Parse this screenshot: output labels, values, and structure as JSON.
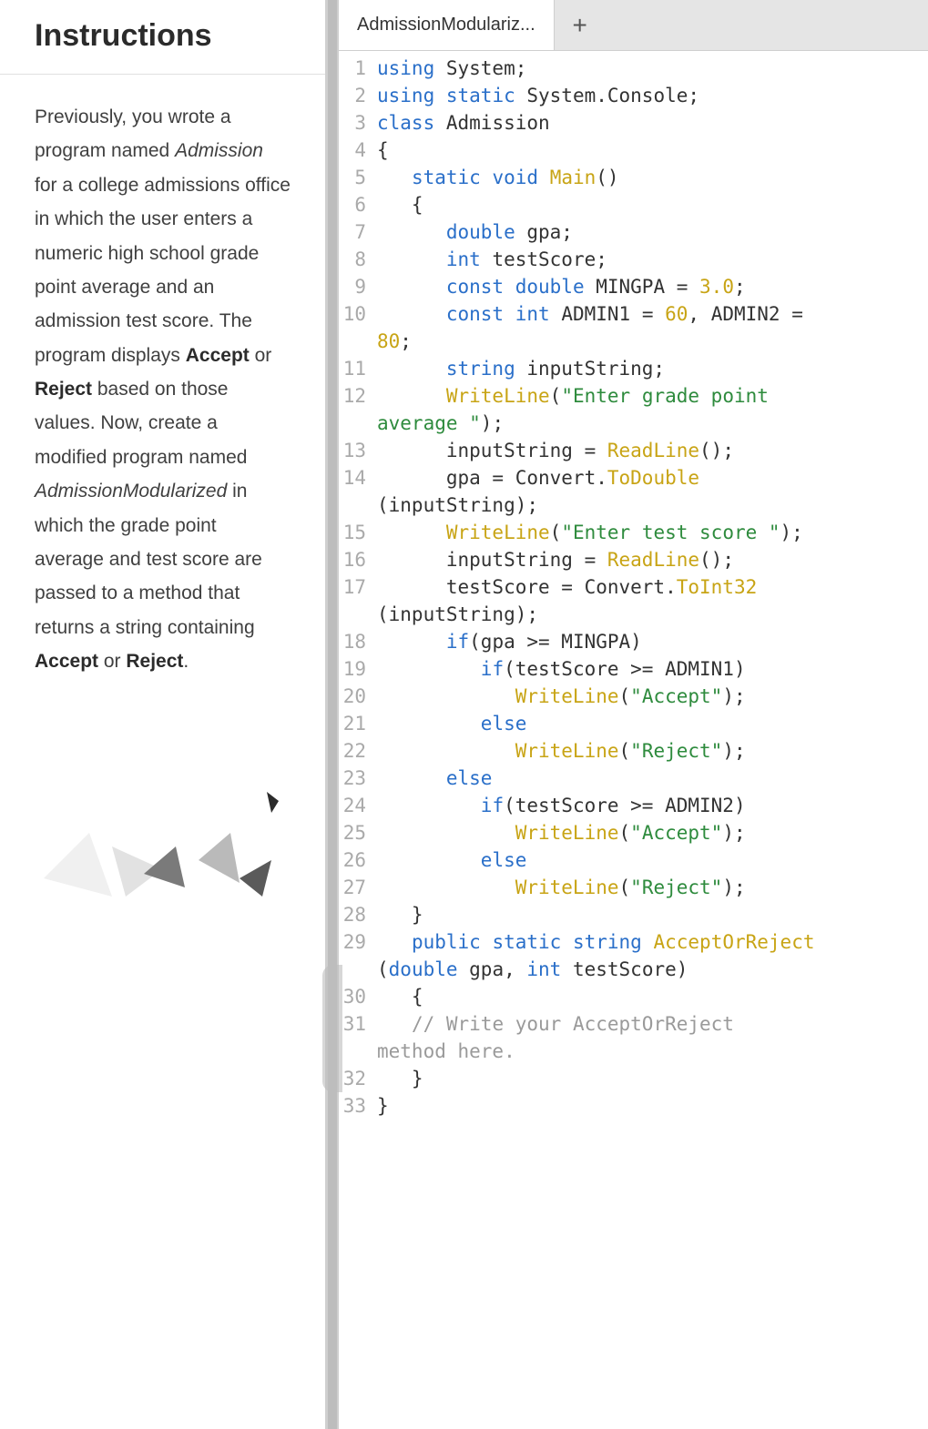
{
  "left": {
    "title": "Instructions",
    "para_parts": [
      {
        "t": "Previously, you wrote a program named "
      },
      {
        "t": "Admission",
        "em": true
      },
      {
        "t": " for a college admissions office in which the user enters a numeric high school grade point average and an admission test score. The program displays "
      },
      {
        "t": "Accept",
        "strong": true
      },
      {
        "t": " or "
      },
      {
        "t": "Reject",
        "strong": true
      },
      {
        "t": " based on those values. Now, create a modified program named "
      },
      {
        "t": "AdmissionModularized",
        "em": true
      },
      {
        "t": " in which the grade point average and test score are passed to a method that returns a string containing "
      },
      {
        "t": "Accept",
        "strong": true
      },
      {
        "t": " or "
      },
      {
        "t": "Reject",
        "strong": true
      },
      {
        "t": "."
      }
    ]
  },
  "tabs": {
    "active_label": "AdmissionModulariz...",
    "add_label": "+"
  },
  "code": {
    "lines": [
      {
        "n": 1,
        "rows": [
          [
            {
              "c": "tk-kw",
              "t": "using"
            },
            {
              "t": " System;"
            }
          ]
        ]
      },
      {
        "n": 2,
        "rows": [
          [
            {
              "c": "tk-kw",
              "t": "using"
            },
            {
              "t": " "
            },
            {
              "c": "tk-kw",
              "t": "static"
            },
            {
              "t": " System.Console;"
            }
          ]
        ]
      },
      {
        "n": 3,
        "rows": [
          [
            {
              "c": "tk-kw",
              "t": "class"
            },
            {
              "t": " "
            },
            {
              "c": "tk-cls",
              "t": "Admission"
            }
          ]
        ]
      },
      {
        "n": 4,
        "rows": [
          [
            {
              "t": "{"
            }
          ]
        ]
      },
      {
        "n": 5,
        "rows": [
          [
            {
              "t": "   "
            },
            {
              "c": "tk-kw",
              "t": "static"
            },
            {
              "t": " "
            },
            {
              "c": "tk-kw",
              "t": "void"
            },
            {
              "t": " "
            },
            {
              "c": "tk-fn",
              "t": "Main"
            },
            {
              "t": "()"
            }
          ]
        ]
      },
      {
        "n": 6,
        "rows": [
          [
            {
              "t": "   {"
            }
          ]
        ]
      },
      {
        "n": 7,
        "rows": [
          [
            {
              "t": "      "
            },
            {
              "c": "tk-type",
              "t": "double"
            },
            {
              "t": " gpa;"
            }
          ]
        ]
      },
      {
        "n": 8,
        "rows": [
          [
            {
              "t": "      "
            },
            {
              "c": "tk-type",
              "t": "int"
            },
            {
              "t": " testScore;"
            }
          ]
        ]
      },
      {
        "n": 9,
        "rows": [
          [
            {
              "t": "      "
            },
            {
              "c": "tk-kw",
              "t": "const"
            },
            {
              "t": " "
            },
            {
              "c": "tk-type",
              "t": "double"
            },
            {
              "t": " MINGPA = "
            },
            {
              "c": "tk-num",
              "t": "3.0"
            },
            {
              "t": ";"
            }
          ]
        ]
      },
      {
        "n": 10,
        "rows": [
          [
            {
              "t": "      "
            },
            {
              "c": "tk-kw",
              "t": "const"
            },
            {
              "t": " "
            },
            {
              "c": "tk-type",
              "t": "int"
            },
            {
              "t": " ADMIN1 = "
            },
            {
              "c": "tk-num",
              "t": "60"
            },
            {
              "t": ", ADMIN2 = "
            }
          ],
          [
            {
              "c": "tk-num",
              "t": "80"
            },
            {
              "t": ";"
            }
          ]
        ]
      },
      {
        "n": 11,
        "rows": [
          [
            {
              "t": "      "
            },
            {
              "c": "tk-type",
              "t": "string"
            },
            {
              "t": " inputString;"
            }
          ]
        ]
      },
      {
        "n": 12,
        "rows": [
          [
            {
              "t": "      "
            },
            {
              "c": "tk-fn",
              "t": "WriteLine"
            },
            {
              "t": "("
            },
            {
              "c": "tk-str",
              "t": "\"Enter grade point "
            }
          ],
          [
            {
              "c": "tk-str",
              "t": "average \""
            },
            {
              "t": ");"
            }
          ]
        ]
      },
      {
        "n": 13,
        "rows": [
          [
            {
              "t": "      inputString = "
            },
            {
              "c": "tk-fn",
              "t": "ReadLine"
            },
            {
              "t": "();"
            }
          ]
        ]
      },
      {
        "n": 14,
        "rows": [
          [
            {
              "t": "      gpa = Convert."
            },
            {
              "c": "tk-fn",
              "t": "ToDouble"
            }
          ],
          [
            {
              "t": "(inputString);"
            }
          ]
        ]
      },
      {
        "n": 15,
        "rows": [
          [
            {
              "t": "      "
            },
            {
              "c": "tk-fn",
              "t": "WriteLine"
            },
            {
              "t": "("
            },
            {
              "c": "tk-str",
              "t": "\"Enter test score \""
            },
            {
              "t": ");"
            }
          ]
        ]
      },
      {
        "n": 16,
        "rows": [
          [
            {
              "t": "      inputString = "
            },
            {
              "c": "tk-fn",
              "t": "ReadLine"
            },
            {
              "t": "();"
            }
          ]
        ]
      },
      {
        "n": 17,
        "rows": [
          [
            {
              "t": "      testScore = Convert."
            },
            {
              "c": "tk-fn",
              "t": "ToInt32"
            }
          ],
          [
            {
              "t": "(inputString);"
            }
          ]
        ]
      },
      {
        "n": 18,
        "rows": [
          [
            {
              "t": "      "
            },
            {
              "c": "tk-kw",
              "t": "if"
            },
            {
              "t": "(gpa >= MINGPA)"
            }
          ]
        ]
      },
      {
        "n": 19,
        "rows": [
          [
            {
              "t": "         "
            },
            {
              "c": "tk-kw",
              "t": "if"
            },
            {
              "t": "(testScore >= ADMIN1)"
            }
          ]
        ]
      },
      {
        "n": 20,
        "rows": [
          [
            {
              "t": "            "
            },
            {
              "c": "tk-fn",
              "t": "WriteLine"
            },
            {
              "t": "("
            },
            {
              "c": "tk-str",
              "t": "\"Accept\""
            },
            {
              "t": ");"
            }
          ]
        ]
      },
      {
        "n": 21,
        "rows": [
          [
            {
              "t": "         "
            },
            {
              "c": "tk-kw",
              "t": "else"
            }
          ]
        ]
      },
      {
        "n": 22,
        "rows": [
          [
            {
              "t": "            "
            },
            {
              "c": "tk-fn",
              "t": "WriteLine"
            },
            {
              "t": "("
            },
            {
              "c": "tk-str",
              "t": "\"Reject\""
            },
            {
              "t": ");"
            }
          ]
        ]
      },
      {
        "n": 23,
        "rows": [
          [
            {
              "t": "      "
            },
            {
              "c": "tk-kw",
              "t": "else"
            }
          ]
        ]
      },
      {
        "n": 24,
        "rows": [
          [
            {
              "t": "         "
            },
            {
              "c": "tk-kw",
              "t": "if"
            },
            {
              "t": "(testScore >= ADMIN2)"
            }
          ]
        ]
      },
      {
        "n": 25,
        "rows": [
          [
            {
              "t": "            "
            },
            {
              "c": "tk-fn",
              "t": "WriteLine"
            },
            {
              "t": "("
            },
            {
              "c": "tk-str",
              "t": "\"Accept\""
            },
            {
              "t": ");"
            }
          ]
        ]
      },
      {
        "n": 26,
        "rows": [
          [
            {
              "t": "         "
            },
            {
              "c": "tk-kw",
              "t": "else"
            }
          ]
        ]
      },
      {
        "n": 27,
        "rows": [
          [
            {
              "t": "            "
            },
            {
              "c": "tk-fn",
              "t": "WriteLine"
            },
            {
              "t": "("
            },
            {
              "c": "tk-str",
              "t": "\"Reject\""
            },
            {
              "t": ");"
            }
          ]
        ]
      },
      {
        "n": 28,
        "rows": [
          [
            {
              "t": "   }"
            }
          ]
        ]
      },
      {
        "n": 29,
        "rows": [
          [
            {
              "t": "   "
            },
            {
              "c": "tk-kw",
              "t": "public"
            },
            {
              "t": " "
            },
            {
              "c": "tk-kw",
              "t": "static"
            },
            {
              "t": " "
            },
            {
              "c": "tk-type",
              "t": "string"
            },
            {
              "t": " "
            },
            {
              "c": "tk-fn",
              "t": "AcceptOrReject"
            }
          ],
          [
            {
              "t": "("
            },
            {
              "c": "tk-type",
              "t": "double"
            },
            {
              "t": " gpa, "
            },
            {
              "c": "tk-type",
              "t": "int"
            },
            {
              "t": " testScore)"
            }
          ]
        ]
      },
      {
        "n": 30,
        "rows": [
          [
            {
              "t": "   {"
            }
          ]
        ]
      },
      {
        "n": 31,
        "rows": [
          [
            {
              "t": "   "
            },
            {
              "c": "tk-cmt",
              "t": "// Write your AcceptOrReject "
            }
          ],
          [
            {
              "c": "tk-cmt",
              "t": "method here."
            }
          ]
        ]
      },
      {
        "n": 32,
        "rows": [
          [
            {
              "t": "   }"
            }
          ]
        ]
      },
      {
        "n": 33,
        "rows": [
          [
            {
              "t": "}"
            }
          ]
        ]
      }
    ]
  }
}
